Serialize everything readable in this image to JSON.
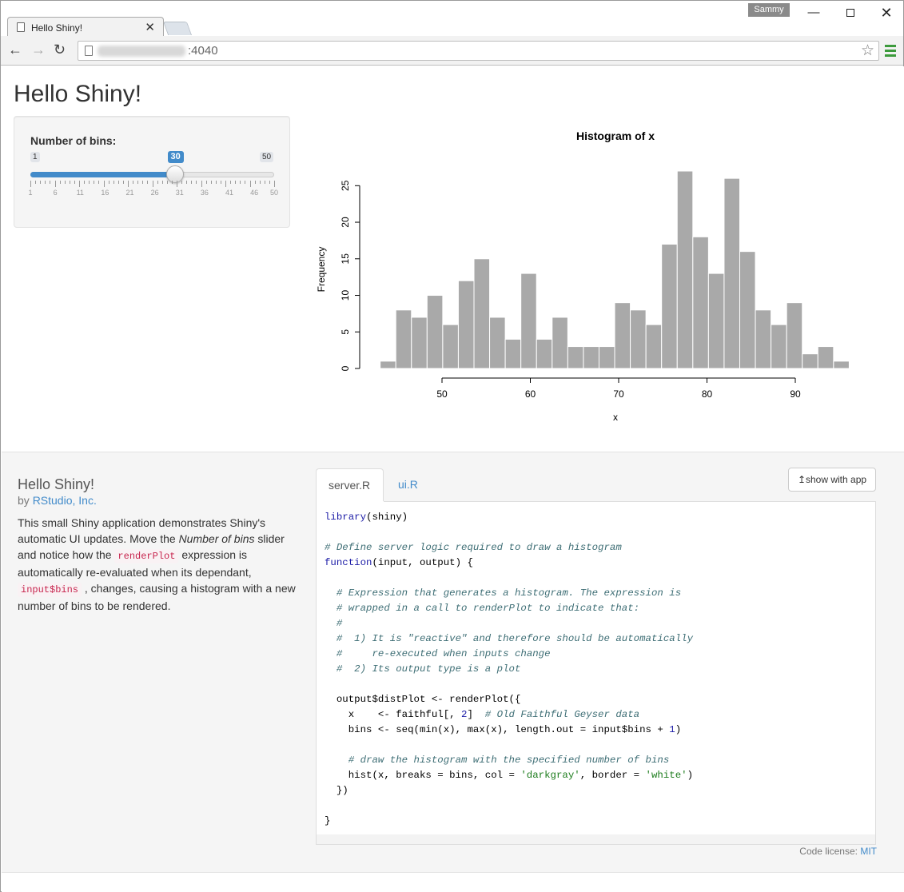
{
  "browser": {
    "tab_title": "Hello Shiny!",
    "tab_close": "✕",
    "profile": "Sammy",
    "url_suffix": ":4040",
    "star": "☆",
    "back": "←",
    "forward": "→",
    "reload": "↻",
    "win_min": "—",
    "win_close": "✕"
  },
  "app": {
    "title": "Hello Shiny!",
    "slider": {
      "label": "Number of bins:",
      "min": 1,
      "max": 50,
      "value": 30,
      "ticks": [
        "1",
        "6",
        "11",
        "16",
        "21",
        "26",
        "31",
        "36",
        "41",
        "46",
        "50"
      ]
    }
  },
  "chart_data": {
    "type": "bar",
    "title": "Histogram of x",
    "xlabel": "x",
    "ylabel": "Frequency",
    "bin_start": 43,
    "bin_width": 1.77,
    "values": [
      1,
      8,
      7,
      10,
      6,
      12,
      15,
      7,
      4,
      13,
      4,
      7,
      3,
      3,
      3,
      9,
      8,
      6,
      17,
      27,
      18,
      13,
      26,
      16,
      8,
      6,
      9,
      2,
      3,
      1
    ],
    "xticks": [
      50,
      60,
      70,
      80,
      90
    ],
    "yticks": [
      0,
      5,
      10,
      15,
      20,
      25
    ],
    "ylim": [
      0,
      27
    ],
    "colors": {
      "bar": "#a9a9a9",
      "border": "#ffffff"
    }
  },
  "showcase": {
    "title": "Hello Shiny!",
    "by": "by ",
    "author": "RStudio, Inc.",
    "desc_1": "This small Shiny application demonstrates Shiny's automatic UI updates. Move the ",
    "desc_em": "Number of bins",
    "desc_2": " slider and notice how the ",
    "desc_code1": "renderPlot",
    "desc_3": " expression is automatically re-evaluated when its dependant, ",
    "desc_code2": "input$bins",
    "desc_4": " , changes, causing a histogram with a new number of bins to be rendered.",
    "tab_server": "server.R",
    "tab_ui": "ui.R",
    "show_button": "↥show with app",
    "license_label": "Code license: ",
    "license_link": "MIT",
    "code_lines": [
      "library(shiny)",
      "",
      "# Define server logic required to draw a histogram",
      "function(input, output) {",
      "",
      "  # Expression that generates a histogram. The expression is",
      "  # wrapped in a call to renderPlot to indicate that:",
      "  #",
      "  #  1) It is \"reactive\" and therefore should be automatically",
      "  #     re-executed when inputs change",
      "  #  2) Its output type is a plot",
      "",
      "  output$distPlot <- renderPlot({",
      "    x    <- faithful[, 2]  # Old Faithful Geyser data",
      "    bins <- seq(min(x), max(x), length.out = input$bins + 1)",
      "",
      "    # draw the histogram with the specified number of bins",
      "    hist(x, breaks = bins, col = 'darkgray', border = 'white')",
      "  })",
      "",
      "}"
    ]
  }
}
